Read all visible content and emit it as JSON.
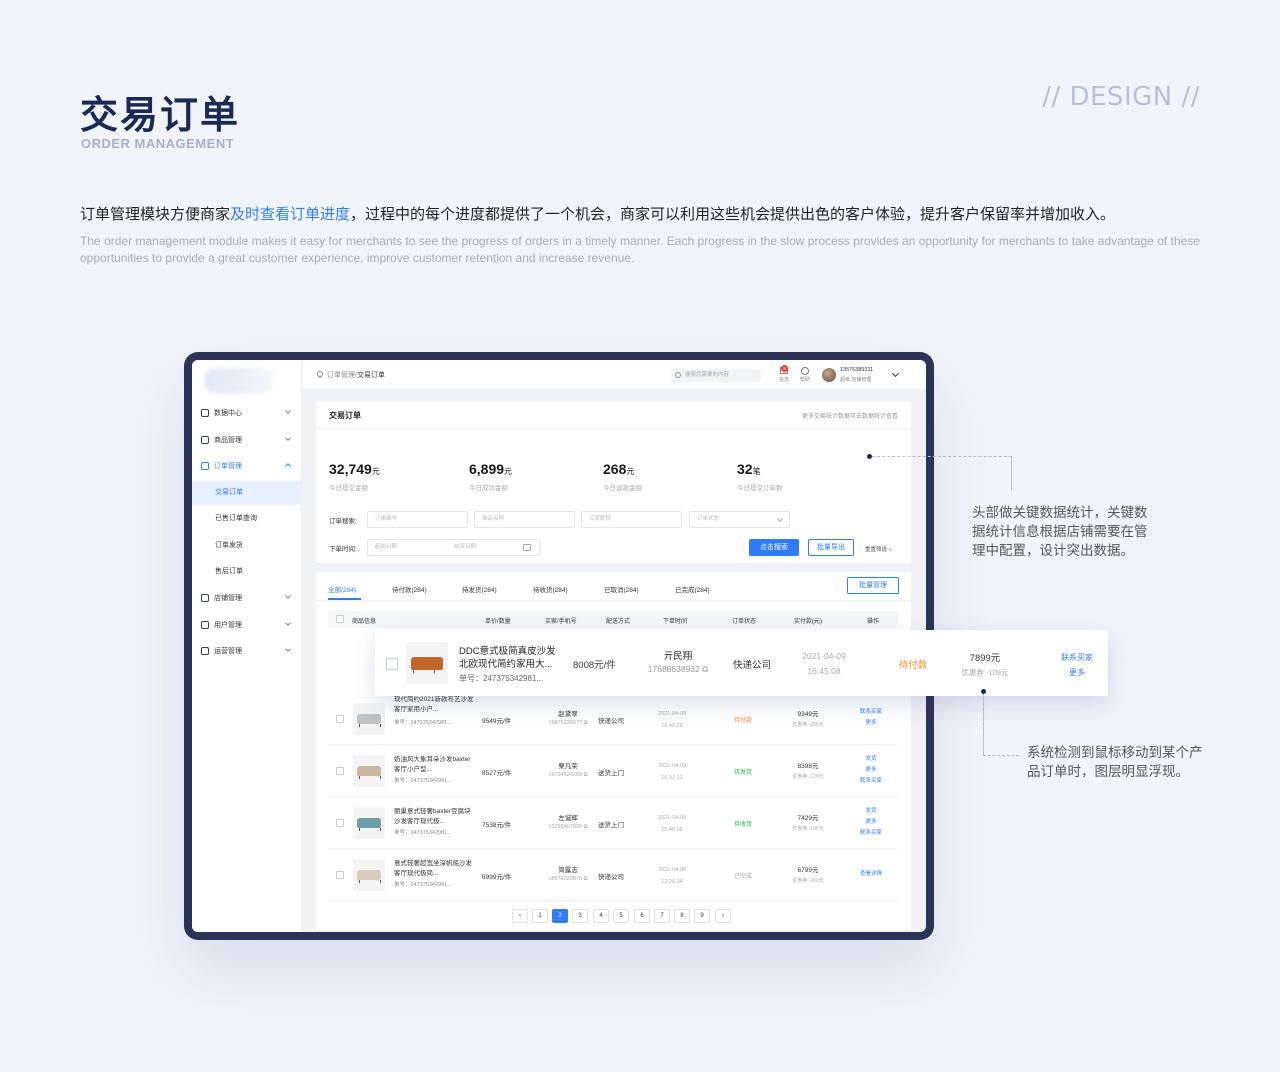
{
  "header": {
    "title": "交易订单",
    "subtitle": "ORDER MANAGEMENT",
    "design_tag": "// DESIGN //",
    "intro_cn_pre": "订单管理模块方便商家",
    "intro_cn_highlight": "及时查看订单进度",
    "intro_cn_post": "，过程中的每个进度都提供了一个机会，商家可以利用这些机会提供出色的客户体验，提升客户保留率并增加收入。",
    "intro_en": "The order management module makes it easy for merchants to see the progress of orders in a timely manner. Each progress in the slow process provides an opportunity for merchants to take advantage of these opportunities to provide a great customer experience, improve customer retention and increase revenue.",
    "highlight_color": "#2f7cf6"
  },
  "sidebar": {
    "items": [
      {
        "label": "数据中心",
        "icon": "dashboard-icon"
      },
      {
        "label": "商品管理",
        "icon": "box-icon"
      },
      {
        "label": "订单管理",
        "icon": "clipboard-icon"
      },
      {
        "label": "店铺管理",
        "icon": "store-icon"
      },
      {
        "label": "用户管理",
        "icon": "user-icon"
      },
      {
        "label": "运营管理",
        "icon": "chart-icon"
      }
    ],
    "subitems": [
      "交易订单",
      "已售订单查询",
      "订单发货",
      "售后订单"
    ]
  },
  "topbar": {
    "breadcrumb_parent": "订单管理/",
    "breadcrumb_current": "交易订单",
    "search_placeholder": "搜索您需要的内容",
    "msg_label": "信息",
    "msg_badge": "9",
    "help_label": "帮助",
    "user_phone": "13576389311",
    "user_role": "超级  店铺管理"
  },
  "summary": {
    "title": "交易订单",
    "link": "更多交易统计数据可去数据统计查看",
    "stats": [
      {
        "value": "32,749",
        "unit": "元",
        "label": "今日提交金额"
      },
      {
        "value": "6,899",
        "unit": "元",
        "label": "今日成功金额"
      },
      {
        "value": "268",
        "unit": "元",
        "label": "今日退款金额"
      },
      {
        "value": "32",
        "unit": "笔",
        "label": "今日提交订单数"
      }
    ],
    "filters": {
      "search_label": "订单搜索:",
      "order_no": "订单编号",
      "product_name": "商品名称",
      "buyer_nick": "买家昵称",
      "order_status": "订单状态",
      "time_label": "下单时间:",
      "start_date": "起始日期",
      "end_date": "结束日期",
      "search_btn": "点击搜索",
      "export_btn": "批量导出",
      "reset": "重置筛选"
    }
  },
  "orders": {
    "tabs": [
      "全部(284)",
      "待付款(284)",
      "待发货(284)",
      "待收货(284)",
      "已取消(284)",
      "已完成(284)"
    ],
    "batch_btn": "批量管理",
    "columns": [
      "商品信息",
      "单价/数量",
      "买家/手机号",
      "配送方式",
      "下单时间",
      "订单状态",
      "实付款(元)",
      "操作"
    ],
    "rows": [
      {
        "name": "现代简约2021新款布艺沙发客厅家用小户...",
        "no": "单号：247375342981...",
        "price": "9549元/件",
        "buyer": "赵黛翠",
        "phone": "19876235577",
        "ship": "快递公司",
        "date": "2021-04-09",
        "time": "16:40:29",
        "status": "待付款",
        "status_color": "#f78a23",
        "paid": "9349元",
        "disc": "优惠券:-200元",
        "ops": [
          "联系买家",
          "更多"
        ],
        "sofa_color": "#bfc3c6"
      },
      {
        "name": "奶油风大象耳朵沙发baxter客厅小户型...",
        "no": "单号：247375342981...",
        "price": "8527元/件",
        "buyer": "栗凡荣",
        "phone": "16734526689",
        "ship": "送货上门",
        "date": "2021-04-09",
        "time": "16:32:13",
        "status": "待发货",
        "status_color": "#2bb34c",
        "paid": "8398元",
        "disc": "优惠券:-129元",
        "ops": [
          "发货",
          "更多",
          "联系买家"
        ],
        "sofa_color": "#c7b6a0"
      },
      {
        "name": "丽巢意式轻奢baxter豆腐块沙发客厅现代极...",
        "no": "单号：247375342981...",
        "price": "7538元/件",
        "buyer": "左诚辉",
        "phone": "13255467899",
        "ship": "送货上门",
        "date": "2021-04-09",
        "time": "15:45:08",
        "status": "待收货",
        "status_color": "#2bb34c",
        "paid": "7429元",
        "disc": "优惠券:-100元",
        "ops": [
          "发货",
          "更多",
          "联系买家"
        ],
        "sofa_color": "#6f9ea6"
      },
      {
        "name": "意式轻奢超宽坐深帆船沙发客厅现代极简...",
        "no": "单号：247375342981...",
        "price": "6999元/件",
        "buyer": "简露志",
        "phone": "18976328876",
        "ship": "快递公司",
        "date": "2021-04-08",
        "time": "12:26:34",
        "status": "已完成",
        "status_color": "#aaaaaa",
        "paid": "6799元",
        "disc": "优惠券:-200元",
        "ops": [
          "查看详情"
        ],
        "sofa_color": "#d7cdbd"
      }
    ],
    "pages": [
      "1",
      "2",
      "3",
      "4",
      "5",
      "6",
      "7",
      "8",
      "9"
    ],
    "current_page": "2"
  },
  "hover_row": {
    "name": "DDC意式极简真皮沙发北欧现代简约家用大...",
    "no": "单号：247375342981...",
    "price": "8008元/件",
    "buyer": "亓民翔",
    "phone": "17688638932",
    "ship": "快递公司",
    "date": "2021-04-09",
    "time": "16:45:08",
    "status": "待付款",
    "paid": "7899元",
    "disc": "优惠券:-109元",
    "ops": [
      "联系买家",
      "更多"
    ],
    "sofa_color": "#c0672e"
  },
  "annotations": {
    "stats_note": "头部做关键数据统计，关键数据统计信息根据店铺需要在管理中配置，设计突出数据。",
    "hover_note": "系统检测到鼠标移动到某个产品订单时，图层明显浮现。"
  }
}
